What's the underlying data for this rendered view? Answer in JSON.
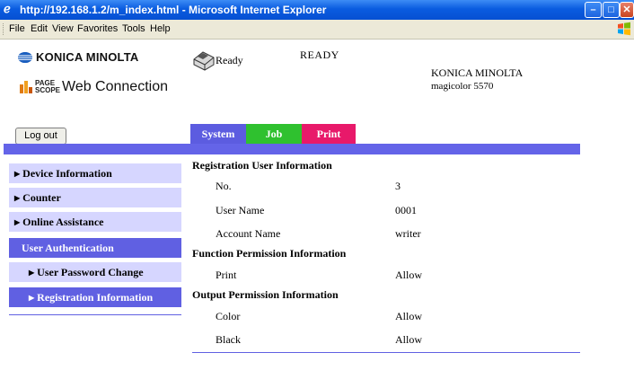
{
  "window": {
    "title": "http://192.168.1.2/m_index.html - Microsoft Internet Explorer",
    "icon": "ie-icon",
    "controls": [
      "minimize-icon",
      "maximize-icon",
      "close-icon"
    ]
  },
  "menubar": {
    "items": [
      "File",
      "Edit",
      "View",
      "Favorites",
      "Tools",
      "Help"
    ]
  },
  "header": {
    "logo_text": "KONICA MINOLTA",
    "pagescope_small_1": "PAGE",
    "pagescope_small_2": "SCOPE",
    "pagescope_web": "Web Connection",
    "printer_status": "Ready",
    "status_big": "READY",
    "brand": "KONICA MINOLTA",
    "model": "magicolor 5570",
    "logout": "Log out"
  },
  "tabs": {
    "system": "System",
    "job": "Job",
    "print": "Print",
    "colors": {
      "system": "#5c5ce0",
      "job": "#2fc12f",
      "print": "#e8196a"
    }
  },
  "sidebar": {
    "items": [
      {
        "label": "Device Information",
        "arrow": "▶"
      },
      {
        "label": "Counter",
        "arrow": "▶"
      },
      {
        "label": "Online Assistance",
        "arrow": "▶"
      },
      {
        "label": "User Authentication",
        "arrow": ""
      },
      {
        "label": "User Password Change",
        "arrow": "▶"
      },
      {
        "label": "Registration Information",
        "arrow": "▶"
      }
    ]
  },
  "main": {
    "registration_head": "Registration User Information",
    "no_label": "No.",
    "no_value": "3",
    "user_name_label": "User Name",
    "user_name_value": "0001",
    "account_label": "Account Name",
    "account_value": "writer",
    "function_head": "Function Permission Information",
    "print_label": "Print",
    "print_value": "Allow",
    "output_head": "Output Permission Information",
    "color_label": "Color",
    "color_value": "Allow",
    "black_label": "Black",
    "black_value": "Allow"
  }
}
